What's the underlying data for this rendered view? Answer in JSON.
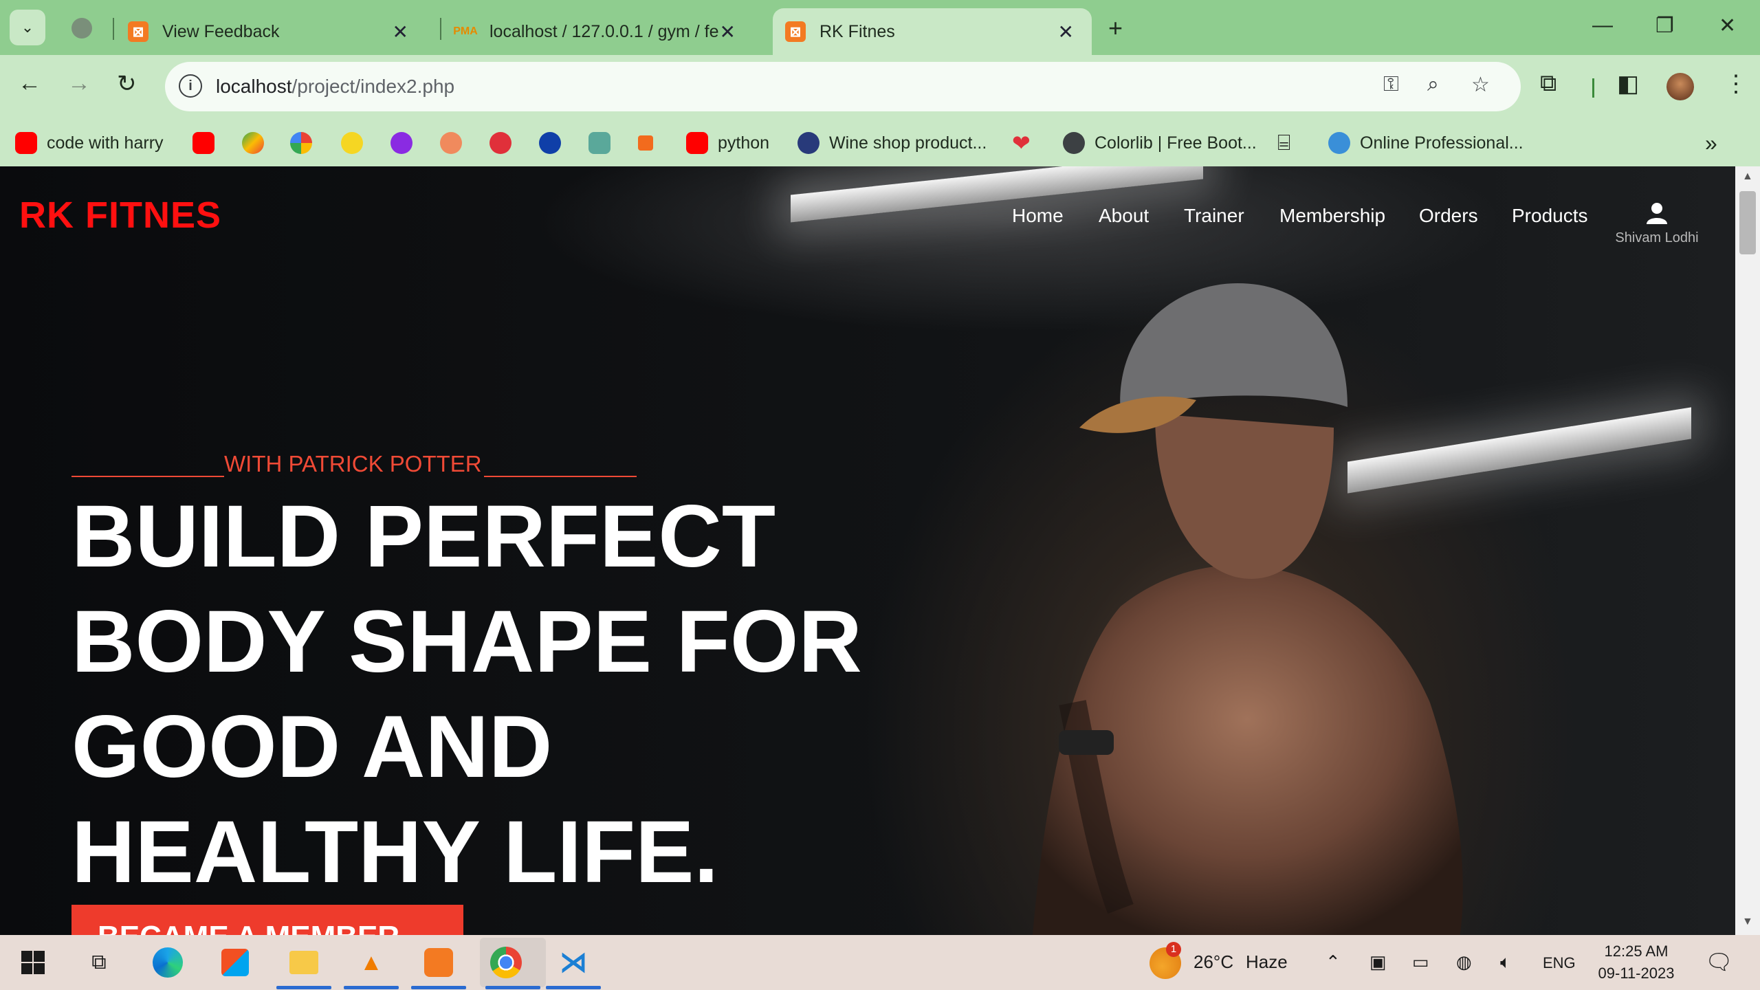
{
  "browser": {
    "tabs": [
      {
        "label": "View Feedback",
        "favicon": "xampp-icon"
      },
      {
        "label": "localhost / 127.0.0.1 / gym / fe",
        "favicon": "phpmyadmin-icon"
      },
      {
        "label": "RK Fitnes",
        "favicon": "xampp-icon",
        "active": true
      }
    ],
    "url_host": "localhost",
    "url_path": "/project/index2.php",
    "bookmarks": [
      {
        "label": "code with harry",
        "icon": "youtube-icon"
      },
      {
        "label": "",
        "icon": "youtube-icon"
      },
      {
        "label": "",
        "icon": "maps-icon"
      },
      {
        "label": "",
        "icon": "google-icon"
      },
      {
        "label": "",
        "icon": "flipkart-icon"
      },
      {
        "label": "",
        "icon": "upgrad-icon"
      },
      {
        "label": "",
        "icon": "app-icon"
      },
      {
        "label": "",
        "icon": "app-icon"
      },
      {
        "label": "",
        "icon": "app-icon"
      },
      {
        "label": "",
        "icon": "chatgpt-icon"
      },
      {
        "label": "",
        "icon": "app-icon"
      },
      {
        "label": "python",
        "icon": "youtube-icon"
      },
      {
        "label": "Wine shop product...",
        "icon": "site-icon"
      },
      {
        "label": "",
        "icon": "heart-icon"
      },
      {
        "label": "Colorlib | Free Boot...",
        "icon": "globe-icon"
      },
      {
        "label": "",
        "icon": "site-icon"
      },
      {
        "label": "Online Professional...",
        "icon": "site-icon"
      }
    ]
  },
  "site": {
    "logo": "RK FITNES",
    "nav": [
      "Home",
      "About",
      "Trainer",
      "Membership",
      "Orders",
      "Products"
    ],
    "user_name": "Shivam Lodhi",
    "hero": {
      "subtitle": "WITH PATRICK POTTER",
      "headline": "BUILD PERFECT BODY SHAPE FOR GOOD AND HEALTHY LIFE.",
      "cta": "BECAME A MEMBER"
    }
  },
  "taskbar": {
    "weather_temp": "26°C",
    "weather_desc": "Haze",
    "weather_badge": "1",
    "lang": "ENG",
    "time": "12:25 AM",
    "date": "09-11-2023"
  },
  "colors": {
    "logo": "#ff1010",
    "accent": "#ee3b2c",
    "tabstrip": "#8fcd8f",
    "toolbar": "#c9e8c6"
  }
}
